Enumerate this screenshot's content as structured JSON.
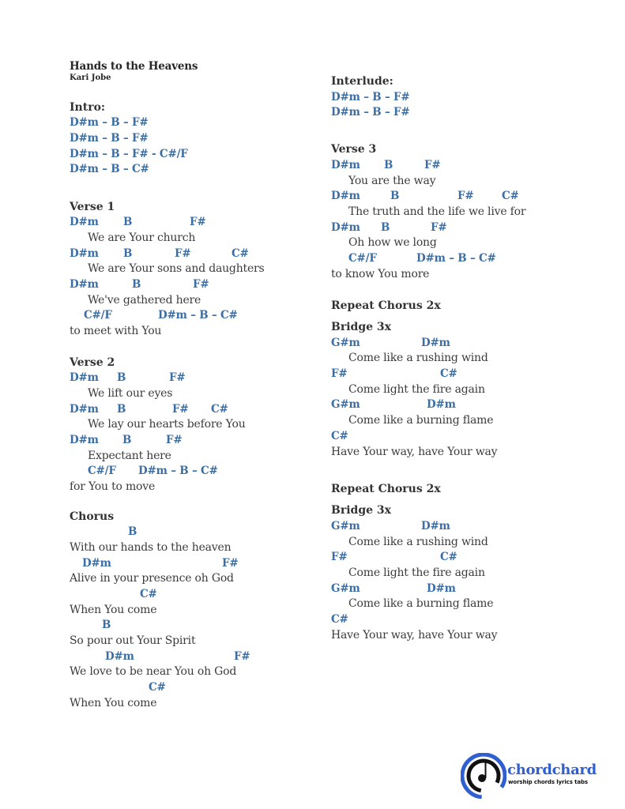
{
  "song": {
    "title": "Hands to the Heavens",
    "artist": "Kari Jobe"
  },
  "intro": {
    "heading": "Intro:",
    "lines": [
      "D#m – B – F#",
      "D#m – B – F#",
      "D#m – B – F# - C#/F",
      "D#m – B – C#"
    ]
  },
  "verse1": {
    "heading": "Verse 1",
    "chords": [
      [
        "D#m",
        "B",
        "F#"
      ],
      [
        "D#m",
        "B",
        "F#",
        "C#"
      ],
      [
        "D#m",
        "B",
        "F#"
      ],
      [
        "C#/F",
        "D#m – B – C#"
      ]
    ],
    "lyrics": [
      "We are Your church",
      "We are Your sons and daughters",
      "We've gathered here",
      "to meet with You"
    ]
  },
  "verse2": {
    "heading": "Verse 2",
    "chords": [
      [
        "D#m",
        "B",
        "F#"
      ],
      [
        "D#m",
        "B",
        "F#",
        "C#"
      ],
      [
        "D#m",
        "B",
        "F#"
      ],
      [
        "C#/F",
        "D#m – B – C#"
      ]
    ],
    "lyrics": [
      "We lift our eyes",
      "We lay our hearts before You",
      "Expectant here",
      "for You to move"
    ]
  },
  "chorus": {
    "heading": "Chorus",
    "chords": [
      [
        "B"
      ],
      [
        "D#m",
        "F#"
      ],
      [
        "C#"
      ],
      [
        "B"
      ],
      [
        "D#m",
        "F#"
      ],
      [
        "C#"
      ]
    ],
    "lyrics": [
      "With our hands to the heaven",
      "Alive in your presence oh God",
      "When You come",
      "So pour out Your Spirit",
      "We love to be near You oh God",
      "When You come"
    ]
  },
  "interlude": {
    "heading": "Interlude:",
    "lines": [
      "D#m – B – F#",
      "D#m – B – F#"
    ]
  },
  "verse3": {
    "heading": "Verse 3",
    "chords": [
      [
        "D#m",
        "B",
        "F#"
      ],
      [
        "D#m",
        "B",
        "F#",
        "C#"
      ],
      [
        "D#m",
        "B",
        "F#"
      ],
      [
        "C#/F",
        "D#m – B – C#"
      ]
    ],
    "lyrics": [
      "You are the way",
      "The truth and the life we live for",
      "Oh how we long",
      "to know You more"
    ]
  },
  "repeat1": "Repeat Chorus 2x",
  "bridge1": {
    "heading": "Bridge 3x",
    "chords": [
      [
        "G#m",
        "D#m"
      ],
      [
        "F#",
        "C#"
      ],
      [
        "G#m",
        "D#m"
      ],
      [
        "C#"
      ]
    ],
    "lyrics": [
      "Come like a rushing wind",
      "Come light the fire again",
      "Come like a burning flame",
      "Have Your way, have Your way"
    ]
  },
  "repeat2": "Repeat Chorus 2x",
  "bridge2": {
    "heading": "Bridge 3x",
    "chords": [
      [
        "G#m",
        "D#m"
      ],
      [
        "F#",
        "C#"
      ],
      [
        "G#m",
        "D#m"
      ],
      [
        "C#"
      ]
    ],
    "lyrics": [
      "Come like a rushing wind",
      "Come light the fire again",
      "Come like a burning flame",
      "Have Your way, have Your way"
    ]
  },
  "logo": {
    "name": "chordchard",
    "tagline": "worship chords lyrics tabs",
    "ring_text": "chordchard",
    "icon": "music-note-disc-icon"
  },
  "colors": {
    "chord": "#3a6ea5",
    "text": "#333333",
    "logo_blue": "#2f5fd0"
  }
}
